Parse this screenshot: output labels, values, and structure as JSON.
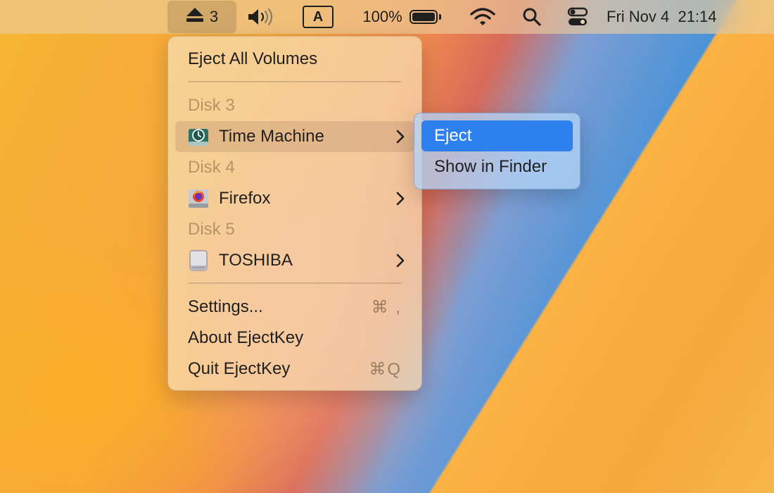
{
  "menubar": {
    "eject_count": "3",
    "input_source": "A",
    "battery": "100%",
    "datetime": "Fri Nov 4  21:14"
  },
  "menu": {
    "eject_all": "Eject All Volumes",
    "disks": [
      {
        "header": "Disk 3",
        "name": "Time Machine",
        "icon": "time-machine-disk-icon"
      },
      {
        "header": "Disk 4",
        "name": "Firefox",
        "icon": "firefox-disk-icon"
      },
      {
        "header": "Disk 5",
        "name": "TOSHIBA",
        "icon": "external-drive-icon"
      }
    ],
    "settings": {
      "label": "Settings...",
      "shortcut": "⌘ ,"
    },
    "about": "About EjectKey",
    "quit": {
      "label": "Quit EjectKey",
      "shortcut": "⌘Q"
    }
  },
  "submenu": {
    "eject": "Eject",
    "show_in_finder": "Show in Finder"
  },
  "colors": {
    "selection": "#2f80ef",
    "menu_bg": "#f8deb4",
    "submenu_bg": "#b2d2f5"
  }
}
